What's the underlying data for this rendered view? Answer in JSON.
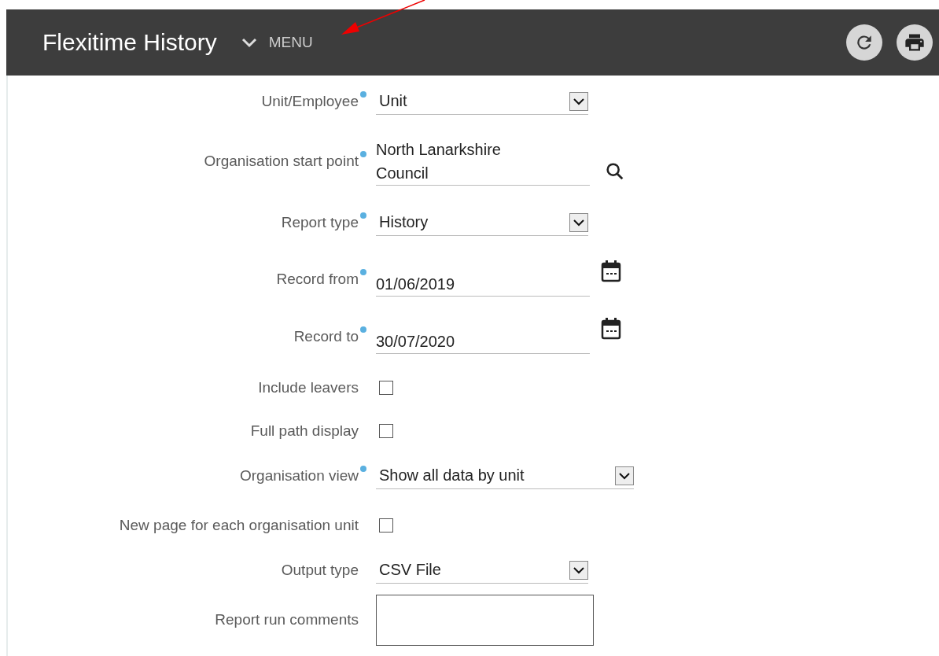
{
  "header": {
    "title": "Flexitime History",
    "menu_label": "MENU"
  },
  "fields": [
    {
      "kind": "select",
      "label": "Unit/Employee",
      "required": true,
      "value": "Unit"
    },
    {
      "kind": "lookup",
      "label": "Organisation start point",
      "required": true,
      "value": "North Lanarkshire\nCouncil"
    },
    {
      "kind": "select",
      "label": "Report type",
      "required": true,
      "value": "History"
    },
    {
      "kind": "date",
      "label": "Record from",
      "required": true,
      "value": "01/06/2019"
    },
    {
      "kind": "date",
      "label": "Record to",
      "required": true,
      "value": "30/07/2020"
    },
    {
      "kind": "checkbox",
      "label": "Include leavers",
      "checked": false
    },
    {
      "kind": "checkbox",
      "label": "Full path display",
      "checked": false
    },
    {
      "kind": "select",
      "label": "Organisation view",
      "required": true,
      "value": "Show all data by unit"
    },
    {
      "kind": "checkbox",
      "label": "New page for each organisation unit",
      "checked": false
    },
    {
      "kind": "select",
      "label": "Output type",
      "required": false,
      "value": "CSV File"
    },
    {
      "kind": "textarea",
      "label": "Report run comments",
      "required": false
    }
  ]
}
